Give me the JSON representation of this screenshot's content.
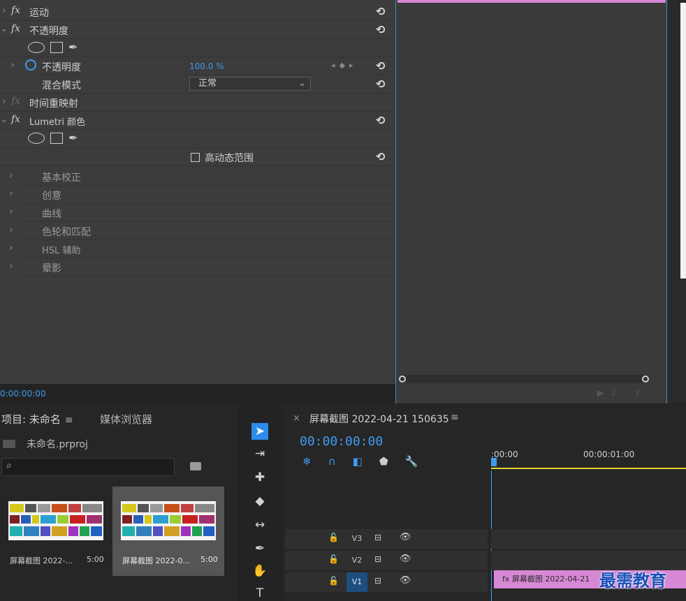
{
  "effect_controls": {
    "rows": [
      {
        "twirl": "›",
        "fx": "fx",
        "label": "运动",
        "reset": "⟲",
        "dim": false
      },
      {
        "twirl": "⌄",
        "fx": "fx",
        "label": "不透明度",
        "reset": "⟲",
        "dim": false
      },
      {
        "twirl": "›",
        "label": "不透明度",
        "value": "100.0 %",
        "reset": "⟲"
      },
      {
        "label": "混合模式",
        "dropdown": "正常",
        "reset": "⟲"
      },
      {
        "twirl": "›",
        "fx": "fx",
        "label": "时间重映射",
        "dim": true
      },
      {
        "twirl": "⌄",
        "fx": "fx",
        "label": "Lumetri 颜色",
        "reset": "⟲"
      },
      {
        "checkbox_label": "高动态范围",
        "reset": "⟲"
      },
      {
        "twirl": "›",
        "label": "基本校正"
      },
      {
        "twirl": "›",
        "label": "创意"
      },
      {
        "twirl": "›",
        "label": "曲线"
      },
      {
        "twirl": "›",
        "label": "色轮和匹配"
      },
      {
        "twirl": "›",
        "label": "HSL 辅助"
      },
      {
        "twirl": "›",
        "label": "晕影"
      }
    ],
    "timecode": "0:00:00:00"
  },
  "project": {
    "tab_project": "项目: 未命名",
    "tab_menu": "≡",
    "tab_media": "媒体浏览器",
    "project_file": "未命名.prproj",
    "search_icon": "⌕",
    "items": [
      {
        "name": "屏幕截图 2022-...",
        "duration": "5:00"
      },
      {
        "name": "屏幕截图 2022-0...",
        "duration": "5:00"
      }
    ]
  },
  "timeline": {
    "close": "×",
    "title": "屏幕截图 2022-04-21 150635",
    "menu": "≡",
    "timecode": "00:00:00:00",
    "ruler": [
      ":00:00",
      "00:00:01:00"
    ],
    "tracks": [
      {
        "lock": "🔓",
        "name": "V3",
        "cam": "⊟",
        "eye": "👁",
        "selected": false
      },
      {
        "lock": "🔓",
        "name": "V2",
        "cam": "⊟",
        "eye": "👁",
        "selected": false
      },
      {
        "lock": "🔓",
        "name": "V1",
        "cam": "⊟",
        "eye": "👁",
        "selected": true
      }
    ],
    "clip_label": "fx  屏幕截图 2022-04-21"
  },
  "watermark": "最需教育",
  "colors": {
    "accent": "#3f9bf0",
    "clip": "#d788d4",
    "playline": "#e6d32f"
  }
}
